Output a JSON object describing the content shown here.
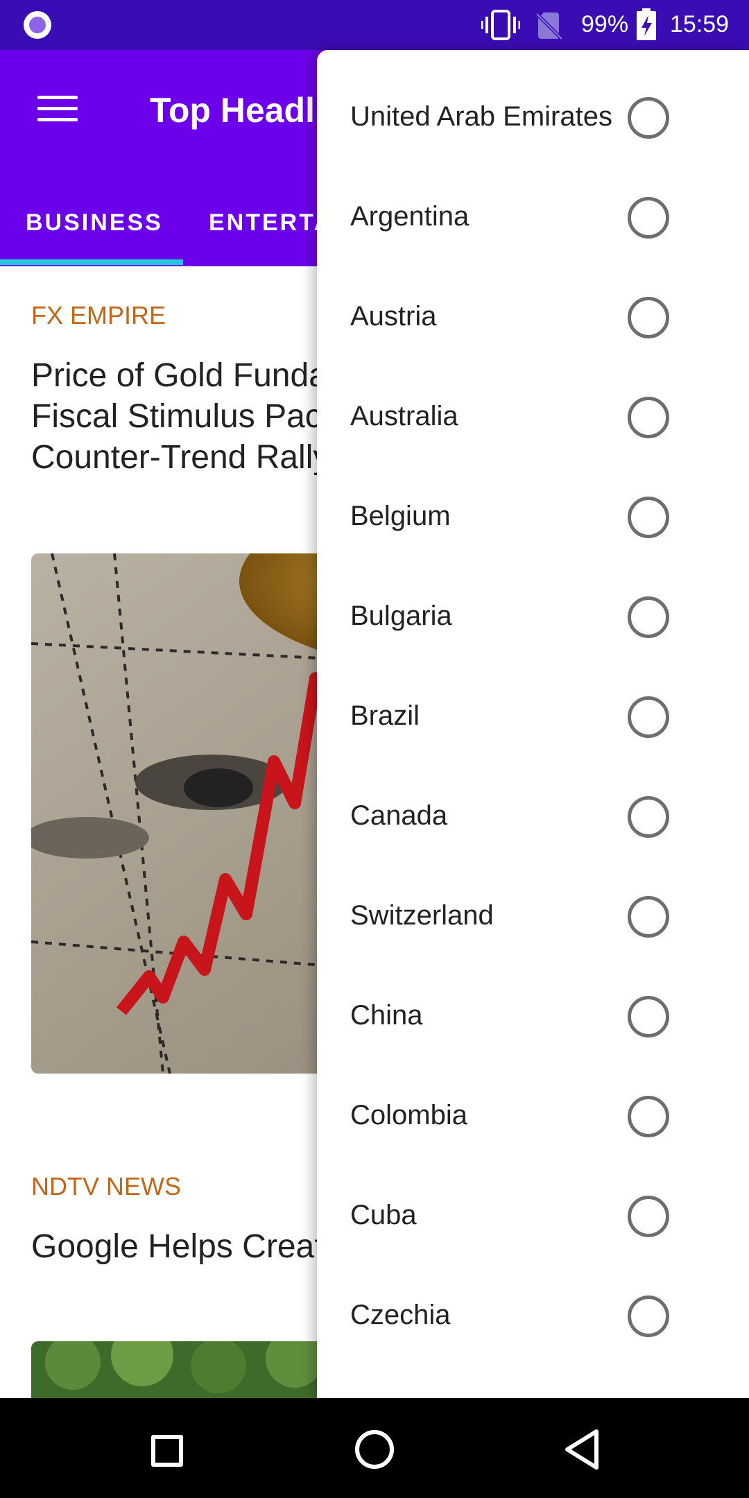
{
  "status_bar": {
    "battery_percent": "99%",
    "time": "15:59",
    "icons": [
      "app-notification-icon",
      "vibrate-icon",
      "no-sim-icon",
      "battery-charging-icon"
    ]
  },
  "app_bar": {
    "title": "Top Headlines",
    "menu_icon": "hamburger-menu-icon",
    "tabs": [
      {
        "label": "BUSINESS",
        "selected": true
      },
      {
        "label": "ENTERTAINMENT",
        "selected": false
      }
    ],
    "accent_color": "#6d00ea",
    "tab_indicator_color": "#24c6dc"
  },
  "articles": [
    {
      "source": "FX EMPIRE",
      "title": "Price of Gold Fundamental Daily Forecast - Fiscal Stimulus Package Too Small to Sustain Counter-Trend Rally - FX Empire"
    },
    {
      "source": "NDTV NEWS",
      "title": "Google Helps Create Unicorns In India - NDTV"
    }
  ],
  "drawer": {
    "countries": [
      {
        "label": "United Arab Emirates",
        "selected": false
      },
      {
        "label": "Argentina",
        "selected": false
      },
      {
        "label": "Austria",
        "selected": false
      },
      {
        "label": "Australia",
        "selected": false
      },
      {
        "label": "Belgium",
        "selected": false
      },
      {
        "label": "Bulgaria",
        "selected": false
      },
      {
        "label": "Brazil",
        "selected": false
      },
      {
        "label": "Canada",
        "selected": false
      },
      {
        "label": "Switzerland",
        "selected": false
      },
      {
        "label": "China",
        "selected": false
      },
      {
        "label": "Colombia",
        "selected": false
      },
      {
        "label": "Cuba",
        "selected": false
      },
      {
        "label": "Czechia",
        "selected": false
      }
    ]
  },
  "nav_bar": {
    "buttons": [
      "recents-icon",
      "home-icon",
      "back-icon"
    ]
  }
}
